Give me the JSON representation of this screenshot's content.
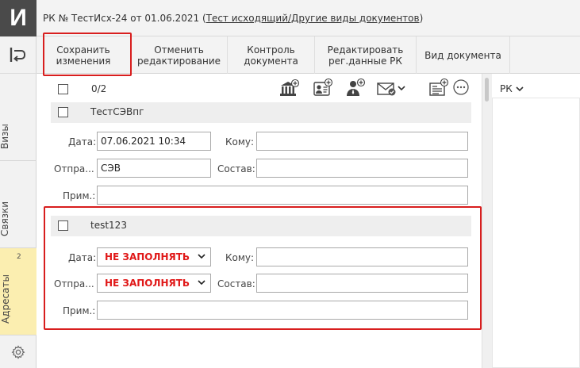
{
  "app": {
    "logo_letter": "И"
  },
  "title": {
    "prefix": "РК № ТестИсх-24 от 01.06.2021",
    "open_paren": "(",
    "link": "Тест исходящий/Другие виды документов",
    "close_paren": ")"
  },
  "toolbar": {
    "save": "Сохранить\nизменения",
    "cancel": "Отменить\nредактирование",
    "control": "Контроль\nдокумента",
    "edit_reg": "Редактировать\nрег.данные РК",
    "doc_kind": "Вид документа"
  },
  "rail": {
    "tab_vizy": "Визы",
    "tab_svyazi": "Связки",
    "tab_adresaty": "Адресаты",
    "adresaty_count": "2"
  },
  "list": {
    "counter": "0/2"
  },
  "rk_panel": {
    "label": "РК"
  },
  "recipients": [
    {
      "name": "ТестСЭВпг",
      "date_label": "Дата:",
      "date_value": "07.06.2021 10:34",
      "komu_label": "Кому:",
      "komu_value": "",
      "sender_label": "Отпра...",
      "sender_value": "СЭВ",
      "sostav_label": "Состав:",
      "sostav_value": "",
      "note_label": "Прим.:",
      "note_value": ""
    },
    {
      "name": "test123",
      "date_label": "Дата:",
      "date_value": "НЕ ЗАПОЛНЯТЬ",
      "komu_label": "Кому:",
      "komu_value": "",
      "sender_label": "Отпра...",
      "sender_value": "НЕ ЗАПОЛНЯТЬ",
      "sostav_label": "Состав:",
      "sostav_value": "",
      "note_label": "Прим.:",
      "note_value": ""
    }
  ],
  "colors": {
    "highlight": "#d81e1e",
    "active_tab": "#fbeeb0",
    "warning_text": "#e01818"
  }
}
